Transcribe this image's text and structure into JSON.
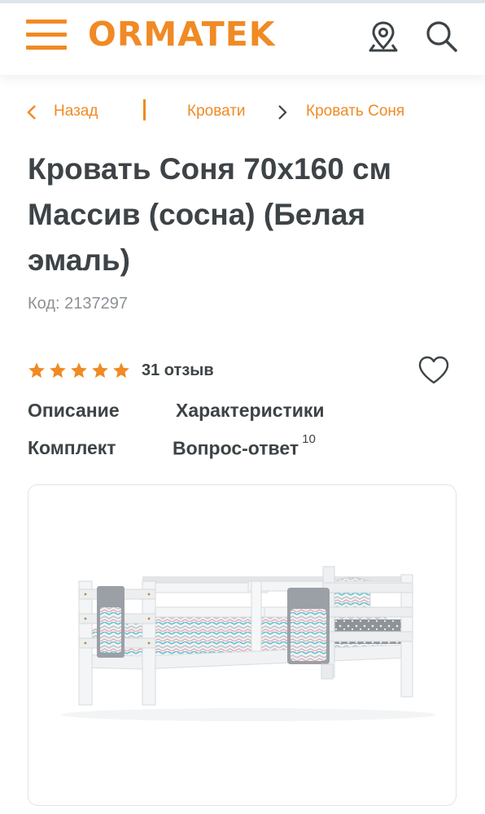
{
  "header": {
    "logo_text": "ORMATEK",
    "accent_color": "#f08a24",
    "menu_icon": "hamburger-menu-icon",
    "location_icon": "location-pin-icon",
    "search_icon": "search-icon"
  },
  "breadcrumbs": {
    "back_label": "Назад",
    "category": "Кровати",
    "current": "Кровать Соня"
  },
  "product": {
    "title": "Кровать Соня 70х160 см Массив (сосна) (Белая эмаль)",
    "code": "Код: 2137297",
    "rating": 5,
    "reviews": "31 отзыв",
    "wishlist_icon": "heart-outline-icon"
  },
  "tabs": {
    "description": "Описание",
    "specs": "Характеристики",
    "kit": "Комплект",
    "qa": "Вопрос-ответ",
    "qa_count": "10"
  }
}
